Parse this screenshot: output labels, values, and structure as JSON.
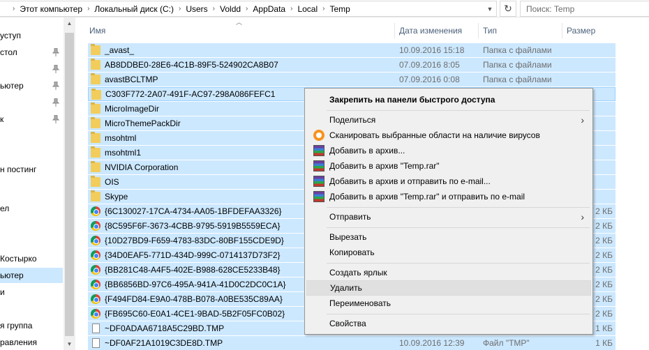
{
  "address": {
    "crumbs": [
      "Этот компьютер",
      "Локальный диск (C:)",
      "Users",
      "Voldd",
      "AppData",
      "Local",
      "Temp"
    ],
    "search_placeholder": "Поиск: Temp"
  },
  "nav": {
    "items": [
      "уступ",
      "стол",
      "ьютер",
      "",
      "к",
      "",
      "",
      "н постинг",
      "",
      "",
      "ел",
      "",
      "",
      "Костырко",
      "ьютер",
      "и",
      "",
      "я группа",
      "равления"
    ],
    "selected_index": 14
  },
  "columns": {
    "name": "Имя",
    "date": "Дата изменения",
    "type": "Тип",
    "size": "Размер"
  },
  "files": [
    {
      "name": "_avast_",
      "icon": "folder-icon",
      "date": "10.09.2016 15:18",
      "type": "Папка с файлами",
      "size": ""
    },
    {
      "name": "AB8DDBE0-28E6-4C1B-89F5-524902CA8B07",
      "icon": "folder-icon",
      "date": "07.09.2016 8:05",
      "type": "Папка с файлами",
      "size": ""
    },
    {
      "name": "avastBCLTMP",
      "icon": "folder-icon",
      "date": "07.09.2016 0:08",
      "type": "Папка с файлами",
      "size": ""
    },
    {
      "name": "C303F772-2A07-491F-AC97-298A086FEFC1",
      "icon": "folder-icon",
      "date": "",
      "type": "",
      "size": ""
    },
    {
      "name": "MicroImageDir",
      "icon": "folder-icon",
      "date": "",
      "type": "",
      "size": ""
    },
    {
      "name": "MicroThemePackDir",
      "icon": "folder-icon",
      "date": "",
      "type": "",
      "size": ""
    },
    {
      "name": "msohtml",
      "icon": "folder-icon",
      "date": "",
      "type": "",
      "size": ""
    },
    {
      "name": "msohtml1",
      "icon": "folder-icon",
      "date": "",
      "type": "",
      "size": ""
    },
    {
      "name": "NVIDIA Corporation",
      "icon": "folder-icon",
      "date": "",
      "type": "",
      "size": ""
    },
    {
      "name": "OIS",
      "icon": "folder-icon",
      "date": "",
      "type": "",
      "size": ""
    },
    {
      "name": "Skype",
      "icon": "folder-icon",
      "date": "",
      "type": "",
      "size": ""
    },
    {
      "name": "{6C130027-17CA-4734-AA05-1BFDEFAA3326}",
      "icon": "chrome-icon",
      "date": "",
      "type": "",
      "size": "2 КБ"
    },
    {
      "name": "{8C595F6F-3673-4CBB-9795-5919B5559ECA}",
      "icon": "chrome-icon",
      "date": "",
      "type": "",
      "size": "2 КБ"
    },
    {
      "name": "{10D27BD9-F659-4783-83DC-80BF155CDE9D}",
      "icon": "chrome-icon",
      "date": "",
      "type": "",
      "size": "2 КБ"
    },
    {
      "name": "{34D0EAF5-771D-434D-999C-0714137D73F2}",
      "icon": "chrome-icon",
      "date": "",
      "type": "",
      "size": "2 КБ"
    },
    {
      "name": "{BB281C48-A4F5-402E-B988-628CE5233B48}",
      "icon": "chrome-icon",
      "date": "",
      "type": "",
      "size": "2 КБ"
    },
    {
      "name": "{BB6856BD-97C6-495A-941A-41D0C2DC0C1A}",
      "icon": "chrome-icon",
      "date": "",
      "type": "",
      "size": "2 КБ"
    },
    {
      "name": "{F494FD84-E9A0-478B-B078-A0BE535C89AA}",
      "icon": "chrome-icon",
      "date": "",
      "type": "",
      "size": "2 КБ"
    },
    {
      "name": "{FB695C60-E0A1-4CE1-9BAD-5B2F05FC0B02}",
      "icon": "chrome-icon",
      "date": "",
      "type": "",
      "size": "2 КБ"
    },
    {
      "name": "~DF0ADAA6718A5C29BD.TMP",
      "icon": "tmp-file-icon",
      "date": "",
      "type": "",
      "size": "1 КБ"
    },
    {
      "name": "~DF0AF21A1019C3DE8D.TMP",
      "icon": "tmp-file-icon",
      "date": "10.09.2016 12:39",
      "type": "Файл \"TMP\"",
      "size": "1 КБ"
    }
  ],
  "context_menu": {
    "pin": "Закрепить на панели быстрого доступа",
    "share": "Поделиться",
    "scan": "Сканировать выбранные области на наличие вирусов",
    "add_archive": "Добавить в архив...",
    "add_temp_rar": "Добавить в архив \"Temp.rar\"",
    "add_email": "Добавить в архив и отправить по e-mail...",
    "add_temp_rar_email": "Добавить в архив \"Temp.rar\" и отправить по e-mail",
    "send_to": "Отправить",
    "cut": "Вырезать",
    "copy": "Копировать",
    "create_shortcut": "Создать ярлык",
    "delete": "Удалить",
    "rename": "Переименовать",
    "properties": "Свойства"
  },
  "colors": {
    "selection": "#cce8ff",
    "menu_bg": "#f0f0f0",
    "header_text": "#4c607a"
  }
}
